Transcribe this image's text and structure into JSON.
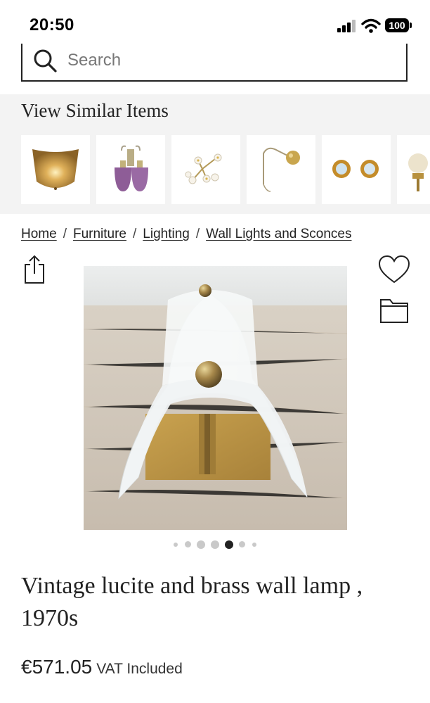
{
  "status_bar": {
    "time": "20:50",
    "battery": "100"
  },
  "search": {
    "placeholder": "Search"
  },
  "similar": {
    "heading": "View Similar Items",
    "items": [
      "amber glass wall sconce",
      "purple glass double sconce",
      "floral porcelain sconce",
      "brass arm globe wall light",
      "pair of round brass sconces",
      "brass glass globe sconce"
    ]
  },
  "breadcrumb": [
    "Home",
    "Furniture",
    "Lighting",
    "Wall Lights and Sconces"
  ],
  "gallery": {
    "dot_count": 7,
    "active_index": 4
  },
  "product": {
    "title": "Vintage lucite and brass wall lamp , 1970s",
    "price": "€571.05",
    "vat": "VAT Included"
  },
  "icons": [
    "search-icon",
    "share-icon",
    "heart-icon",
    "folder-icon",
    "signal-icon",
    "wifi-icon",
    "battery-icon"
  ],
  "colors": {
    "text": "#222222",
    "band": "#f3f3f3",
    "brass": "#b08a3c"
  }
}
